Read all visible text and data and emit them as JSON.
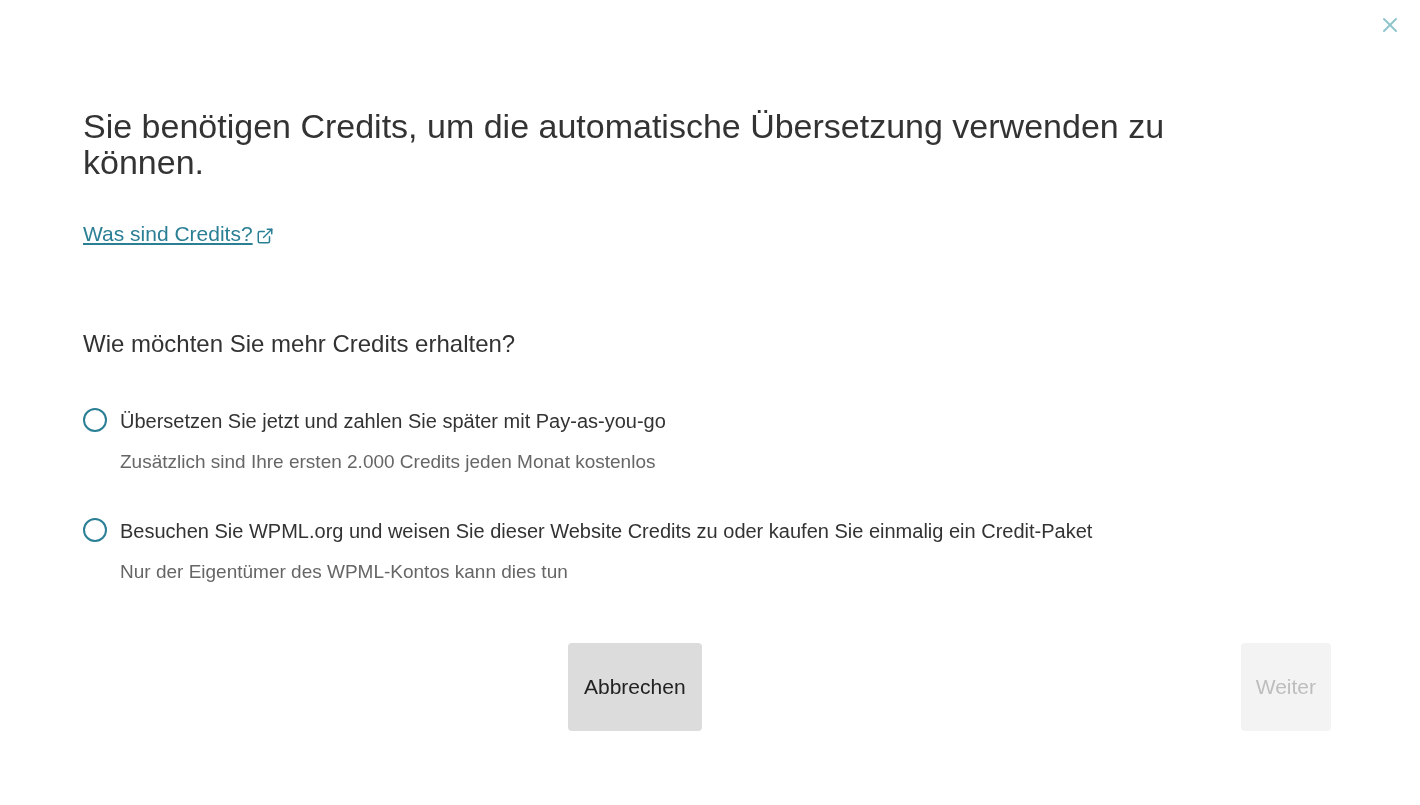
{
  "dialog": {
    "title": "Sie benötigen Credits, um die automatische Übersetzung verwenden zu können.",
    "link": "Was sind Credits?",
    "question": "Wie möchten Sie mehr Credits erhalten?",
    "options": [
      {
        "label": "Übersetzen Sie jetzt und zahlen Sie später mit Pay-as-you-go",
        "hint": "Zusätzlich sind Ihre ersten 2.000 Credits jeden Monat kostenlos",
        "selected": false
      },
      {
        "label": "Besuchen Sie WPML.org und weisen Sie dieser Website Credits zu oder kaufen Sie einmalig ein Credit-Paket",
        "hint": "Nur der Eigentümer des WPML-Kontos kann dies tun",
        "selected": false
      }
    ],
    "buttons": [
      {
        "label": "Abbrechen",
        "disabled": false
      },
      {
        "label": "Weiter",
        "disabled": true
      }
    ]
  }
}
